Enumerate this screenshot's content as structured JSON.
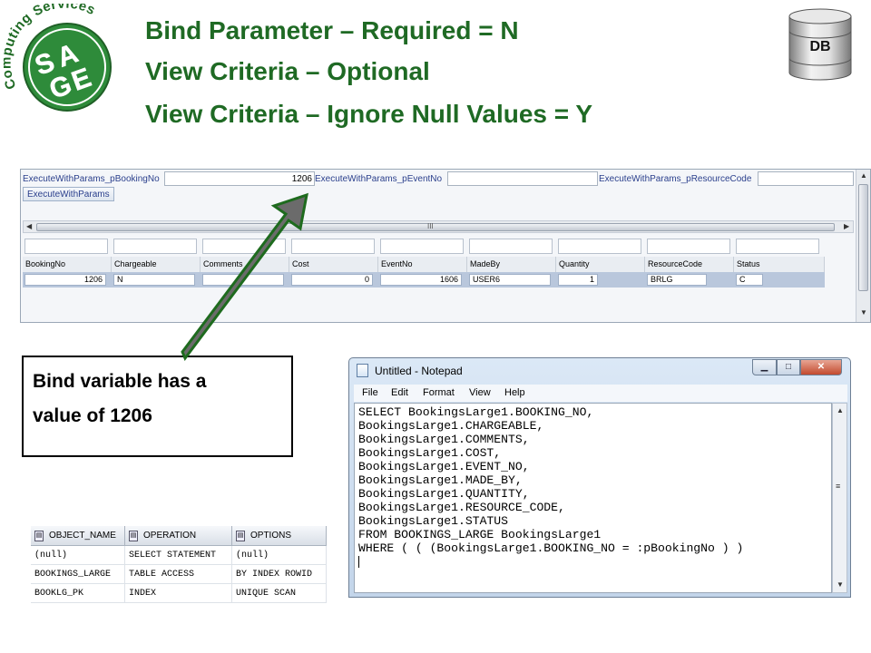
{
  "logo": {
    "arc_text": "Computing Services",
    "letters": [
      "S",
      "A",
      "G",
      "E"
    ]
  },
  "titles": [
    "Bind Parameter – Required = N",
    "View Criteria – Optional",
    "View Criteria – Ignore Null Values = Y"
  ],
  "db_label": "DB",
  "adf": {
    "params": [
      {
        "label": "ExecuteWithParams_pBookingNo",
        "value": "1206"
      },
      {
        "label": "ExecuteWithParams_pEventNo",
        "value": ""
      },
      {
        "label": "ExecuteWithParams_pResourceCode",
        "value": ""
      }
    ],
    "execute_button": "ExecuteWithParams",
    "scroll_grip": "III",
    "columns": [
      "BookingNo",
      "Chargeable",
      "Comments",
      "Cost",
      "EventNo",
      "MadeBy",
      "Quantity",
      "ResourceCode",
      "Status"
    ],
    "row": [
      "1206",
      "N",
      "",
      "0",
      "1606",
      "USER6",
      "1",
      "BRLG",
      "C"
    ]
  },
  "callout": {
    "line1": "Bind variable has a",
    "line2": "value of 1206"
  },
  "plan": {
    "headers": [
      "OBJECT_NAME",
      "OPERATION",
      "OPTIONS"
    ],
    "rows": [
      [
        "(null)",
        "SELECT STATEMENT",
        "(null)"
      ],
      [
        "BOOKINGS_LARGE",
        "TABLE ACCESS",
        "BY INDEX ROWID"
      ],
      [
        "BOOKLG_PK",
        "INDEX",
        "UNIQUE SCAN"
      ]
    ]
  },
  "notepad": {
    "title": "Untitled - Notepad",
    "menus": [
      "File",
      "Edit",
      "Format",
      "View",
      "Help"
    ],
    "lines": [
      "SELECT BookingsLarge1.BOOKING_NO,",
      "BookingsLarge1.CHARGEABLE,",
      "BookingsLarge1.COMMENTS,",
      "BookingsLarge1.COST,",
      "BookingsLarge1.EVENT_NO,",
      "BookingsLarge1.MADE_BY,",
      "BookingsLarge1.QUANTITY,",
      "BookingsLarge1.RESOURCE_CODE,",
      "BookingsLarge1.STATUS",
      "FROM BOOKINGS_LARGE BookingsLarge1",
      "WHERE ( ( (BookingsLarge1.BOOKING_NO = :pBookingNo ) )"
    ]
  },
  "colors": {
    "title_green": "#1f6a24",
    "logo_green": "#2e8b3a",
    "arrow_gray": "#6b6b6b",
    "arrow_border": "#1e6b1e"
  }
}
